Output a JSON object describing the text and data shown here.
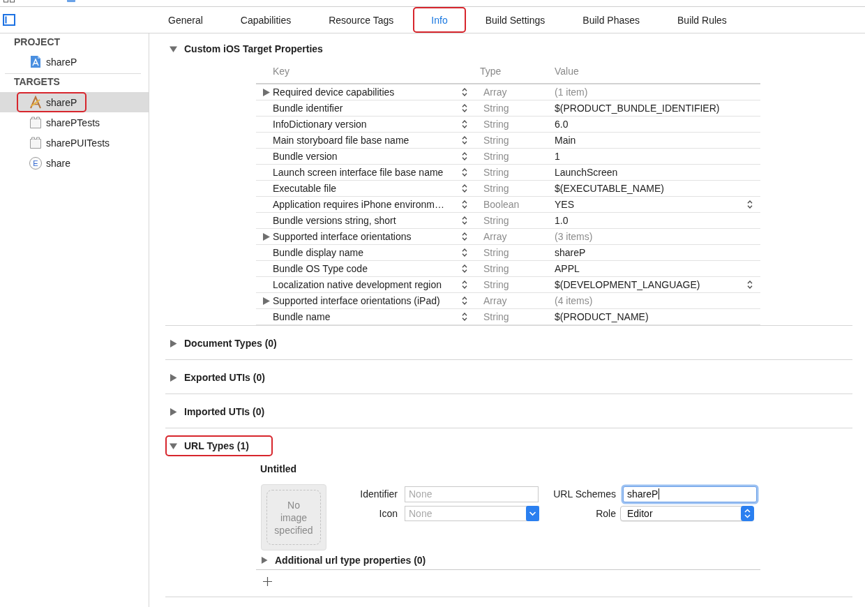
{
  "editor_tabs": [
    {
      "label": "General",
      "selected": false,
      "highlighted": false
    },
    {
      "label": "Capabilities",
      "selected": false,
      "highlighted": false
    },
    {
      "label": "Resource Tags",
      "selected": false,
      "highlighted": false
    },
    {
      "label": "Info",
      "selected": true,
      "highlighted": true
    },
    {
      "label": "Build Settings",
      "selected": false,
      "highlighted": false
    },
    {
      "label": "Build Phases",
      "selected": false,
      "highlighted": false
    },
    {
      "label": "Build Rules",
      "selected": false,
      "highlighted": false
    }
  ],
  "sidebar": {
    "sections": [
      {
        "title": "PROJECT",
        "items": [
          {
            "label": "shareP",
            "kind": "project",
            "selected": false,
            "highlighted": false
          }
        ]
      },
      {
        "title": "TARGETS",
        "items": [
          {
            "label": "shareP",
            "kind": "app",
            "selected": true,
            "highlighted": true
          },
          {
            "label": "sharePTests",
            "kind": "bundle",
            "selected": false,
            "highlighted": false
          },
          {
            "label": "sharePUITests",
            "kind": "bundle",
            "selected": false,
            "highlighted": false
          },
          {
            "label": "share",
            "kind": "extension",
            "icon_letter": "E",
            "selected": false,
            "highlighted": false
          }
        ]
      }
    ]
  },
  "target_properties": {
    "title": "Custom iOS Target Properties",
    "expanded": true,
    "columns": [
      "Key",
      "Type",
      "Value"
    ],
    "rows": [
      {
        "key": "Required device capabilities",
        "type": "Array",
        "value": "(1 item)",
        "expandable": true,
        "popup": false
      },
      {
        "key": "Bundle identifier",
        "type": "String",
        "value": "$(PRODUCT_BUNDLE_IDENTIFIER)",
        "expandable": false,
        "popup": false
      },
      {
        "key": "InfoDictionary version",
        "type": "String",
        "value": "6.0",
        "expandable": false,
        "popup": false
      },
      {
        "key": "Main storyboard file base name",
        "type": "String",
        "value": "Main",
        "expandable": false,
        "popup": false
      },
      {
        "key": "Bundle version",
        "type": "String",
        "value": "1",
        "expandable": false,
        "popup": false
      },
      {
        "key": "Launch screen interface file base name",
        "type": "String",
        "value": "LaunchScreen",
        "expandable": false,
        "popup": false
      },
      {
        "key": "Executable file",
        "type": "String",
        "value": "$(EXECUTABLE_NAME)",
        "expandable": false,
        "popup": false
      },
      {
        "key": "Application requires iPhone environm…",
        "type": "Boolean",
        "value": "YES",
        "expandable": false,
        "popup": true
      },
      {
        "key": "Bundle versions string, short",
        "type": "String",
        "value": "1.0",
        "expandable": false,
        "popup": false
      },
      {
        "key": "Supported interface orientations",
        "type": "Array",
        "value": "(3 items)",
        "expandable": true,
        "popup": false
      },
      {
        "key": "Bundle display name",
        "type": "String",
        "value": "shareP",
        "expandable": false,
        "popup": false
      },
      {
        "key": "Bundle OS Type code",
        "type": "String",
        "value": "APPL",
        "expandable": false,
        "popup": false
      },
      {
        "key": "Localization native development region",
        "type": "String",
        "value": "$(DEVELOPMENT_LANGUAGE)",
        "expandable": false,
        "popup": true
      },
      {
        "key": "Supported interface orientations (iPad)",
        "type": "Array",
        "value": "(4 items)",
        "expandable": true,
        "popup": false
      },
      {
        "key": "Bundle name",
        "type": "String",
        "value": "$(PRODUCT_NAME)",
        "expandable": false,
        "popup": false
      }
    ]
  },
  "sections": [
    {
      "title": "Document Types (0)",
      "expanded": false,
      "highlighted": false
    },
    {
      "title": "Exported UTIs (0)",
      "expanded": false,
      "highlighted": false
    },
    {
      "title": "Imported UTIs (0)",
      "expanded": false,
      "highlighted": false
    },
    {
      "title": "URL Types (1)",
      "expanded": true,
      "highlighted": true,
      "entries": [
        {
          "name": "Untitled",
          "image_placeholder": "No image specified",
          "fields": [
            {
              "kind": "text",
              "label": "Identifier",
              "placeholder": "None",
              "focused": false
            },
            {
              "kind": "text",
              "label": "URL Schemes",
              "value": "shareP",
              "focused": true
            },
            {
              "kind": "combo",
              "label": "Icon",
              "placeholder": "None"
            },
            {
              "kind": "popup",
              "label": "Role",
              "value": "Editor"
            }
          ],
          "additional": {
            "title": "Additional url type properties (0)",
            "expanded": false
          }
        }
      ]
    }
  ]
}
